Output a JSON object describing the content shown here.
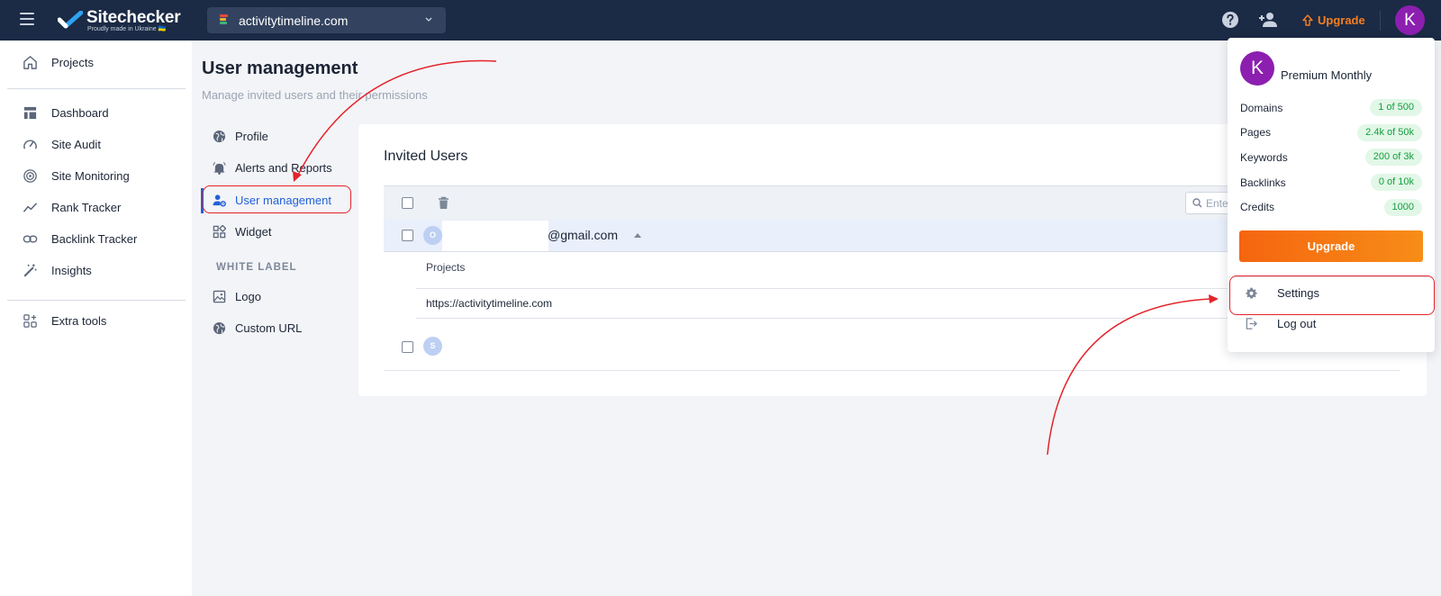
{
  "topbar": {
    "brand_name": "Sitechecker",
    "brand_tagline": "Proudly made in Ukraine 🇺🇦",
    "domain": "activitytimeline.com",
    "upgrade_label": "Upgrade",
    "avatar_letter": "K"
  },
  "sidebar": {
    "items": [
      {
        "label": "Projects",
        "icon": "home-icon"
      },
      {
        "label": "Dashboard",
        "icon": "dashboard-icon"
      },
      {
        "label": "Site Audit",
        "icon": "speedometer-icon"
      },
      {
        "label": "Site Monitoring",
        "icon": "radar-icon"
      },
      {
        "label": "Rank Tracker",
        "icon": "trend-icon"
      },
      {
        "label": "Backlink Tracker",
        "icon": "link-icon"
      },
      {
        "label": "Insights",
        "icon": "magic-wand-icon"
      },
      {
        "label": "Extra tools",
        "icon": "grid-plus-icon"
      }
    ]
  },
  "page": {
    "title": "User management",
    "subtitle": "Manage invited users and their permissions"
  },
  "settings_nav": {
    "items": [
      {
        "label": "Profile",
        "icon": "globe-icon"
      },
      {
        "label": "Alerts and Reports",
        "icon": "bell-icon"
      },
      {
        "label": "User management",
        "icon": "user-gear-icon",
        "active": true
      },
      {
        "label": "Widget",
        "icon": "widget-icon"
      }
    ],
    "section_label": "WHITE LABEL",
    "white_label_items": [
      {
        "label": "Logo",
        "icon": "image-icon"
      },
      {
        "label": "Custom URL",
        "icon": "globe-icon"
      }
    ]
  },
  "invited_users": {
    "title": "Invited Users",
    "search_placeholder": "Enter",
    "rows": [
      {
        "avatar_letter": "O",
        "email": "@gmail.com",
        "expanded": true,
        "projects_label": "Projects",
        "projects": [
          "https://activitytimeline.com"
        ]
      },
      {
        "avatar_letter": "S",
        "email": "",
        "expanded": false
      }
    ]
  },
  "account_menu": {
    "avatar_letter": "K",
    "plan": "Premium Monthly",
    "limits": [
      {
        "label": "Domains",
        "value": "1 of 500"
      },
      {
        "label": "Pages",
        "value": "2.4k of 50k"
      },
      {
        "label": "Keywords",
        "value": "200 of 3k"
      },
      {
        "label": "Backlinks",
        "value": "0 of 10k"
      },
      {
        "label": "Credits",
        "value": "1000"
      }
    ],
    "upgrade_label": "Upgrade",
    "settings_label": "Settings",
    "logout_label": "Log out"
  },
  "colors": {
    "topbar": "#1b2a45",
    "accent_blue": "#2260d8",
    "upgrade_orange": "#f5650f",
    "avatar_purple": "#8c1fb0",
    "badge_green": "#13a03e",
    "annotation_red": "#e3242b"
  }
}
